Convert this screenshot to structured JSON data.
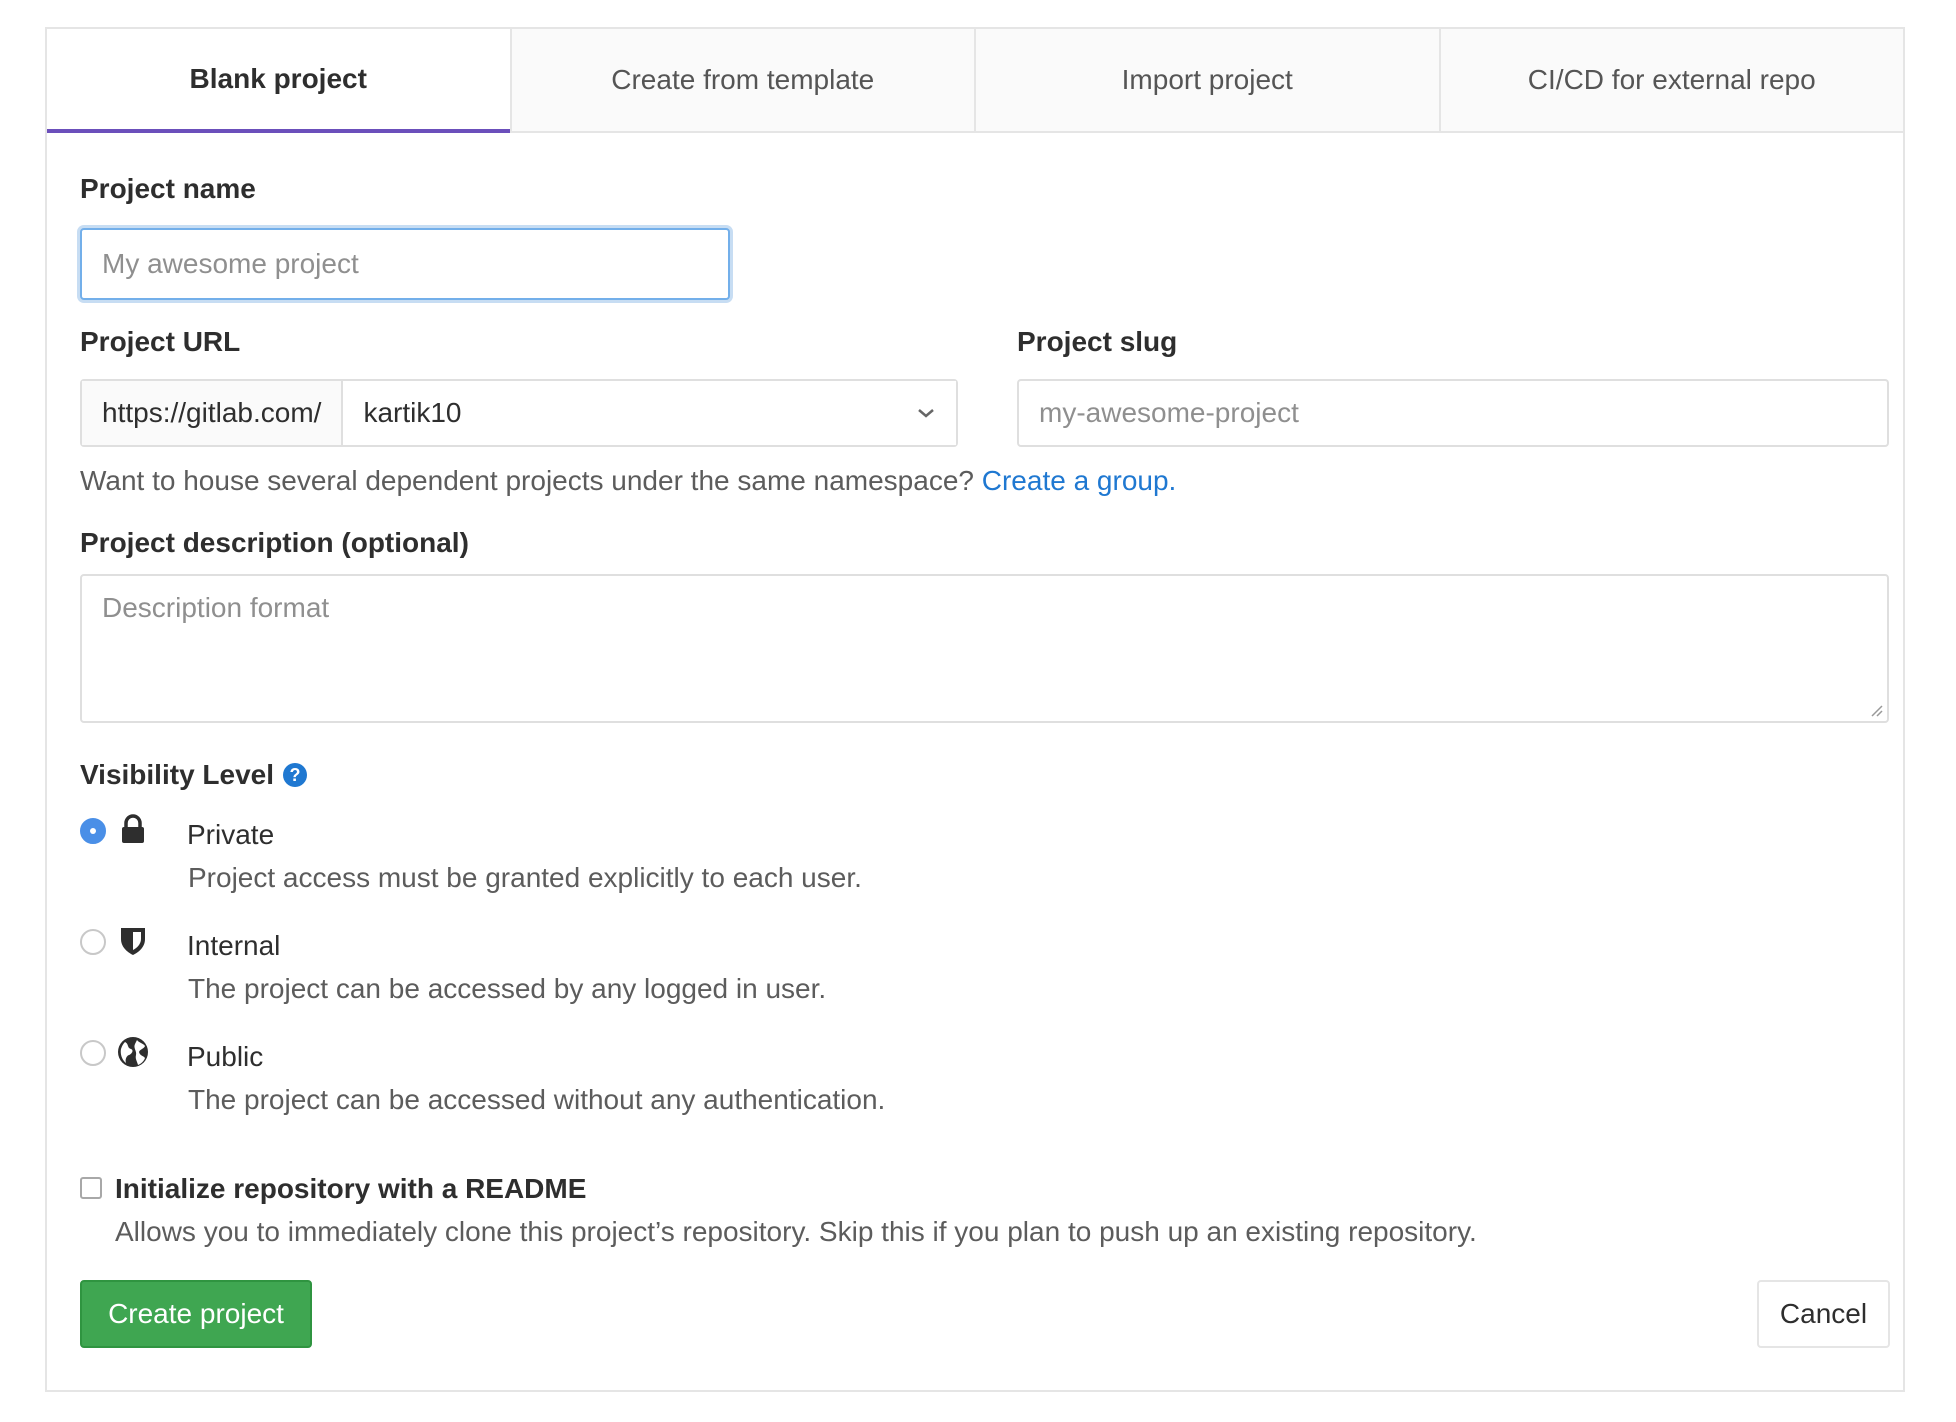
{
  "tabs": [
    {
      "label": "Blank project",
      "active": true
    },
    {
      "label": "Create from template",
      "active": false
    },
    {
      "label": "Import project",
      "active": false
    },
    {
      "label": "CI/CD for external repo",
      "active": false
    }
  ],
  "project_name": {
    "label": "Project name",
    "placeholder": "My awesome project",
    "value": ""
  },
  "project_url": {
    "label": "Project URL",
    "prefix": "https://gitlab.com/",
    "namespace": "kartik10"
  },
  "project_slug": {
    "label": "Project slug",
    "placeholder": "my-awesome-project"
  },
  "namespace_help": {
    "text": "Want to house several dependent projects under the same namespace? ",
    "link": "Create a group."
  },
  "description": {
    "label": "Project description (optional)",
    "placeholder": "Description format"
  },
  "visibility": {
    "label": "Visibility Level",
    "help_icon": "question-circle-icon",
    "selected": "Private",
    "options": [
      {
        "title": "Private",
        "description": "Project access must be granted explicitly to each user.",
        "icon": "lock-icon"
      },
      {
        "title": "Internal",
        "description": "The project can be accessed by any logged in user.",
        "icon": "shield-icon"
      },
      {
        "title": "Public",
        "description": "The project can be accessed without any authentication.",
        "icon": "globe-icon"
      }
    ]
  },
  "readme": {
    "label": "Initialize repository with a README",
    "description": "Allows you to immediately clone this project’s repository. Skip this if you plan to push up an existing repository.",
    "checked": false
  },
  "actions": {
    "create": "Create project",
    "cancel": "Cancel"
  },
  "colors": {
    "accent_tab": "#6b4fbb",
    "link": "#1f78d1",
    "success": "#3fa651",
    "radio_checked": "#4a8fe7"
  }
}
